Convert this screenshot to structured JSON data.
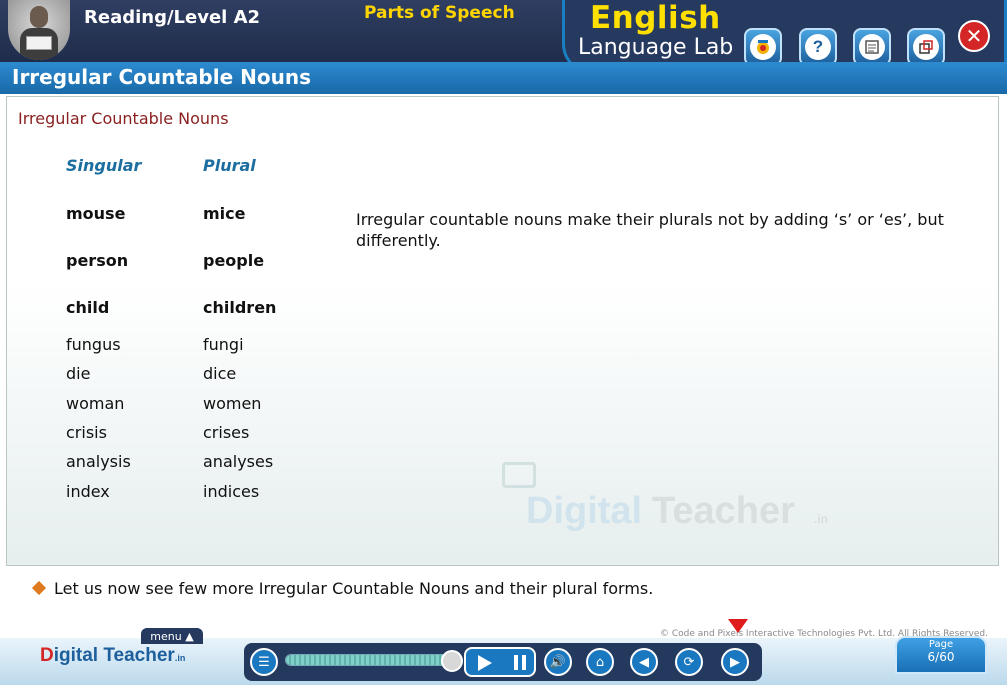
{
  "header": {
    "level_title": "Reading/Level A2",
    "subject": "Parts of Speech",
    "brand_english": "English",
    "brand_lab": "Language Lab",
    "toolbar_icons": [
      "glossary-icon",
      "help-icon",
      "notes-icon",
      "window-icon"
    ],
    "help_glyph": "?",
    "close_glyph": "✕"
  },
  "section": {
    "title": "Irregular Countable Nouns",
    "subtitle": "Irregular Countable Nouns"
  },
  "table": {
    "col_singular": "Singular",
    "col_plural": "Plural",
    "rows": [
      {
        "singular": "mouse",
        "plural": "mice"
      },
      {
        "singular": "person",
        "plural": "people"
      },
      {
        "singular": "child",
        "plural": "children"
      },
      {
        "singular": "fungus",
        "plural": "fungi"
      },
      {
        "singular": "die",
        "plural": "dice"
      },
      {
        "singular": "woman",
        "plural": "women"
      },
      {
        "singular": "crisis",
        "plural": "crises"
      },
      {
        "singular": "analysis",
        "plural": "analyses"
      },
      {
        "singular": "index",
        "plural": "indices"
      }
    ]
  },
  "description": "Irregular countable nouns make their plurals not by adding ‘s’ or ‘es’, but differently.",
  "watermark": {
    "part1": "Digital",
    "part2": "Teacher",
    "suffix": ".in"
  },
  "note": "Let us now see few more Irregular Countable Nouns and their plural forms.",
  "footer": {
    "logo_d": "D",
    "logo_text": "igital Teacher",
    "logo_suffix": ".in",
    "menu_label": "menu",
    "copyright": "© Code and Pixels Interactive Technologies Pvt. Ltd. All Rights Reserved.",
    "progress_fraction": 0.98,
    "page_label": "Page",
    "page_number": "6/60"
  }
}
